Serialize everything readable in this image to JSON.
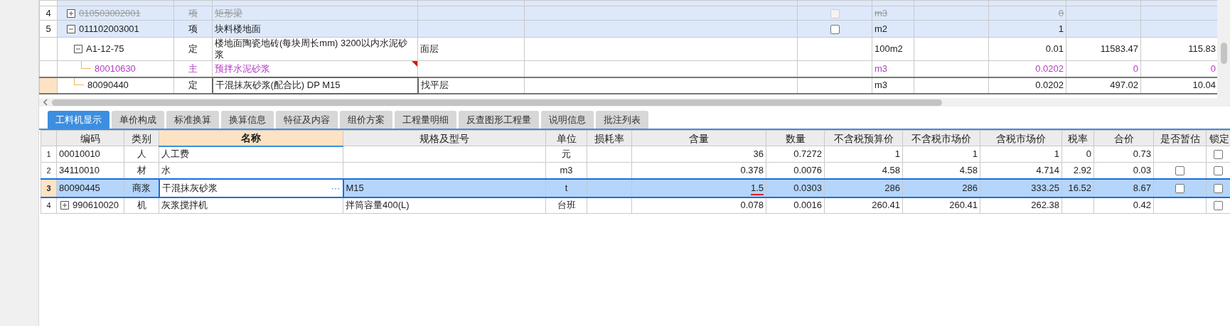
{
  "top_grid": {
    "rows": [
      {
        "column_1": "4",
        "column_2": "010503002001",
        "column_3": "项",
        "column_4": "矩形梁",
        "column_7": {
          "checked": false,
          "disabled": true
        },
        "column_8": "m3",
        "column_10": "0",
        "kind": "item",
        "expanded": false,
        "struck": true,
        "selected": false
      },
      {
        "column_1": "5",
        "column_2": "011102003001",
        "column_3": "项",
        "column_4": "块料楼地面",
        "column_7": {
          "checked": false,
          "disabled": false
        },
        "column_8": "m2",
        "column_10": "1",
        "kind": "item",
        "expanded": true,
        "struck": false,
        "selected": false,
        "children": [
          {
            "column_2": "A1-12-75",
            "column_3": "定",
            "column_4": "楼地面陶瓷地砖(每块周长mm) 3200以内水泥砂浆",
            "column_5": "面层",
            "column_8": "100m2",
            "column_10": "0.01",
            "column_11": "11583.47",
            "column_12": "115.83",
            "kind": "quota",
            "expanded": true,
            "struck": false,
            "selected": false,
            "children": [
              {
                "column_2": "80010630",
                "column_3": "主",
                "column_4": "预拌水泥砂浆",
                "column_8": "m3",
                "column_10": "0.0202",
                "column_11": "0",
                "column_12": "0",
                "kind": "material",
                "struck": false,
                "selected": false,
                "note_marker": true
              }
            ]
          },
          {
            "column_2": "80090440",
            "column_3": "定",
            "column_4": "干混抹灰砂浆(配合比) DP M15",
            "column_5": "找平层",
            "column_8": "m3",
            "column_10": "0.0202",
            "column_11": "497.02",
            "column_12": "10.04",
            "kind": "quota",
            "struck": false,
            "selected": true
          }
        ]
      }
    ]
  },
  "tabs": [
    {
      "label": "工料机显示",
      "selected": true
    },
    {
      "label": "单价构成",
      "selected": false
    },
    {
      "label": "标准换算",
      "selected": false
    },
    {
      "label": "换算信息",
      "selected": false
    },
    {
      "label": "特征及内容",
      "selected": false
    },
    {
      "label": "组价方案",
      "selected": false
    },
    {
      "label": "工程量明细",
      "selected": false
    },
    {
      "label": "反查图形工程量",
      "selected": false
    },
    {
      "label": "说明信息",
      "selected": false
    },
    {
      "label": "批注列表",
      "selected": false
    }
  ],
  "resource_grid": {
    "columns": [
      {
        "label": "编码",
        "selected": false
      },
      {
        "label": "类别",
        "selected": false
      },
      {
        "label": "名称",
        "selected": true
      },
      {
        "label": "规格及型号",
        "selected": false
      },
      {
        "label": "单位",
        "selected": false
      },
      {
        "label": "损耗率",
        "selected": false
      },
      {
        "label": "含量",
        "selected": false
      },
      {
        "label": "数量",
        "selected": false
      },
      {
        "label": "不含税预算价",
        "selected": false
      },
      {
        "label": "不含税市场价",
        "selected": false
      },
      {
        "label": "含税市场价",
        "selected": false
      },
      {
        "label": "税率",
        "selected": false
      },
      {
        "label": "合价",
        "selected": false
      },
      {
        "label": "是否暂估",
        "selected": false
      },
      {
        "label": "锁定",
        "selected": false
      }
    ],
    "rows": [
      {
        "row_number": "1",
        "code": "00010010",
        "type": "人",
        "name": "人工费",
        "unit": "元",
        "content": "36",
        "quantity": "0.7272",
        "budget_price": "1",
        "market_price": "1",
        "market_price_tax": "1",
        "tax_rate": "0",
        "total": "0.73",
        "locked": {
          "checked": false
        },
        "selected": false
      },
      {
        "row_number": "2",
        "code": "34110010",
        "type": "材",
        "name": "水",
        "unit": "m3",
        "content": "0.378",
        "quantity": "0.0076",
        "budget_price": "4.58",
        "market_price": "4.58",
        "market_price_tax": "4.714",
        "tax_rate": "2.92",
        "total": "0.03",
        "provisional": {
          "checked": false
        },
        "locked": {
          "checked": false
        },
        "selected": false
      },
      {
        "row_number": "3",
        "code": "80090445",
        "type": "商浆",
        "name": "干混抹灰砂浆",
        "name_edit_button": "···",
        "spec": "M15",
        "unit": "t",
        "content": "1.5",
        "content_flagged": true,
        "quantity": "0.0303",
        "budget_price": "286",
        "market_price": "286",
        "market_price_tax": "333.25",
        "tax_rate": "16.52",
        "total": "8.67",
        "provisional": {
          "checked": false
        },
        "locked": {
          "checked": false
        },
        "selected": true
      },
      {
        "row_number": "4",
        "code": "990610020",
        "expanded": false,
        "type": "机",
        "name": "灰浆搅拌机",
        "spec": "拌筒容量400(L)",
        "unit": "台班",
        "content": "0.078",
        "quantity": "0.0016",
        "budget_price": "260.41",
        "market_price": "260.41",
        "market_price_tax": "262.38",
        "total": "0.42",
        "locked": {
          "checked": false
        },
        "selected": false
      }
    ]
  }
}
